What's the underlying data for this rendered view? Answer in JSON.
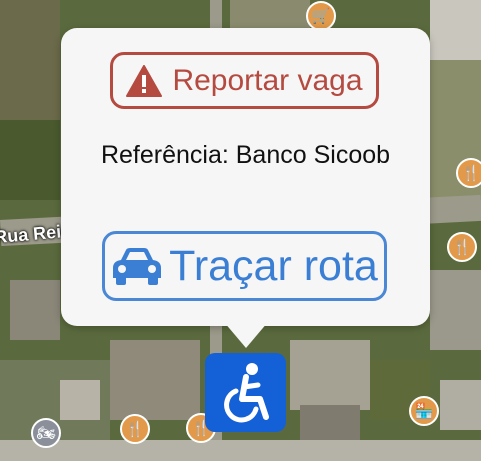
{
  "map": {
    "street_name": "Rua Reinoldo Matte",
    "poi_icons": [
      "cart-icon",
      "fork-knife-icon",
      "motorcycle-icon",
      "store-icon"
    ]
  },
  "popup": {
    "report_label": "Reportar vaga",
    "reference_text": "Referência: Banco Sicoob",
    "route_label": "Traçar rota"
  },
  "marker": {
    "icon": "wheelchair-icon",
    "color": "#1460d6"
  },
  "colors": {
    "report": "#b44a40",
    "route": "#3b7fd4"
  }
}
